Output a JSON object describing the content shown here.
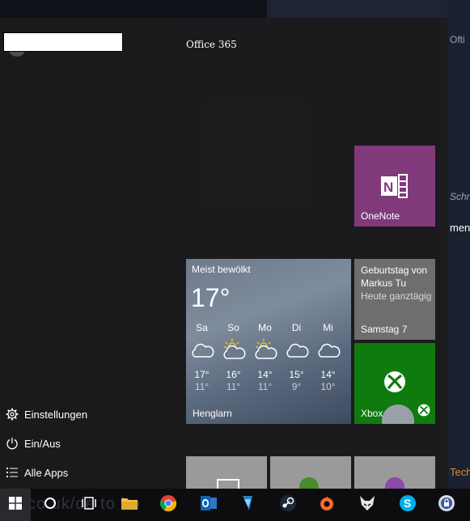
{
  "background": {
    "right_text_1": "Ofti",
    "right_text_2": "Schri",
    "right_text_3": "menu",
    "right_text_4": "Tech"
  },
  "start_menu": {
    "group_title": "Office 365",
    "left_items": [
      {
        "label": "Einstellungen",
        "icon": "gear-icon"
      },
      {
        "label": "Ein/Aus",
        "icon": "power-icon"
      },
      {
        "label": "Alle Apps",
        "icon": "all-apps-icon"
      }
    ],
    "tiles": {
      "onenote": {
        "label": "OneNote",
        "color": "#80397b"
      },
      "weather": {
        "condition": "Meist bewölkt",
        "temp": "17°",
        "location": "Henglarn",
        "days": [
          {
            "name": "Sa",
            "icon": "cloud",
            "hi": "17°",
            "lo": "11°"
          },
          {
            "name": "So",
            "icon": "sun-cloud",
            "hi": "16°",
            "lo": "11°"
          },
          {
            "name": "Mo",
            "icon": "sun-cloud",
            "hi": "14°",
            "lo": "11°"
          },
          {
            "name": "Di",
            "icon": "cloud",
            "hi": "15°",
            "lo": "9°"
          },
          {
            "name": "Mi",
            "icon": "cloud",
            "hi": "14°",
            "lo": "10°"
          }
        ]
      },
      "calendar": {
        "title": "Geburtstag von Markus Tu",
        "subtitle": "Heute ganztägig",
        "date": "Samstag 7"
      },
      "xbox": {
        "label": "Xbox",
        "color": "#0f7b0f"
      }
    }
  },
  "taskbar": {
    "watermark": "co.uk/de to ho",
    "items": [
      "start-icon",
      "cortana-icon",
      "task-view-icon",
      "file-explorer-icon",
      "chrome-icon",
      "outlook-icon",
      "app-icon",
      "steam-icon",
      "origin-icon",
      "fox-icon",
      "skype-icon",
      "vpn-icon"
    ]
  }
}
